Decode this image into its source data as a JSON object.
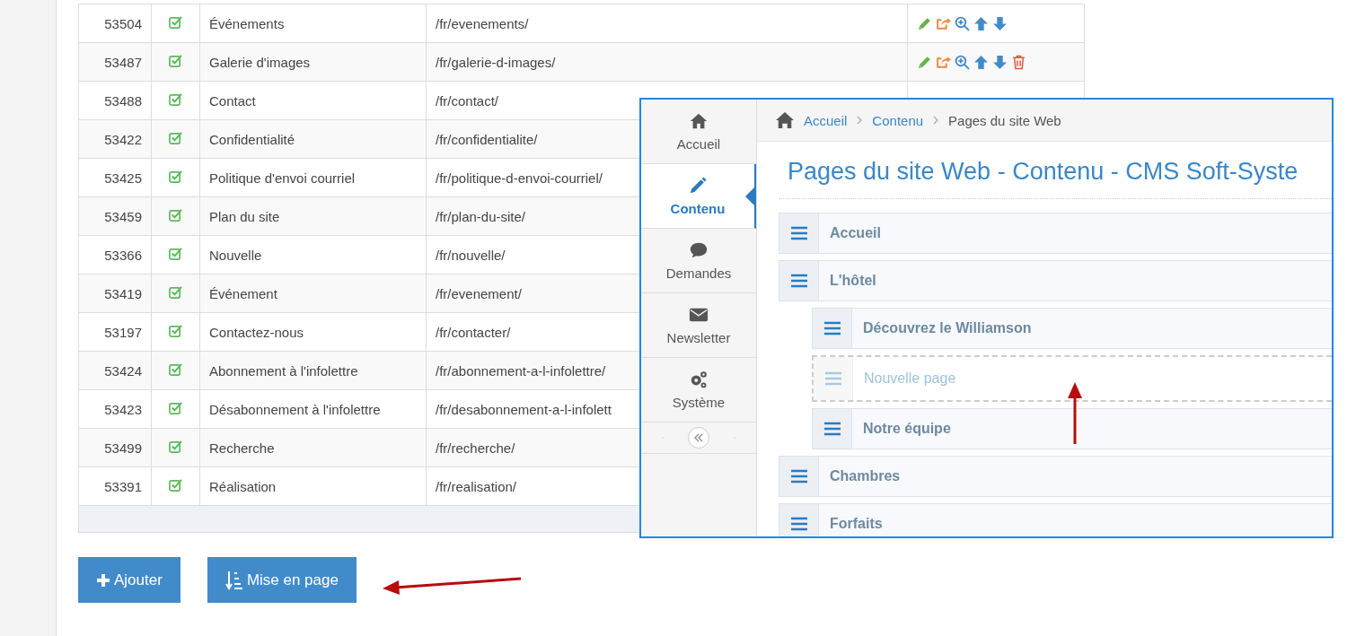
{
  "table": {
    "rows": [
      {
        "id": "53504",
        "published": true,
        "title": "Événements",
        "path": "/fr/evenements/",
        "actions": [
          {
            "kind": "edit"
          },
          {
            "kind": "share"
          },
          {
            "kind": "zoom"
          },
          {
            "kind": "up"
          },
          {
            "kind": "down"
          }
        ]
      },
      {
        "id": "53487",
        "published": true,
        "title": "Galerie d'images",
        "path": "/fr/galerie-d-images/",
        "actions": [
          {
            "kind": "edit"
          },
          {
            "kind": "share"
          },
          {
            "kind": "zoom"
          },
          {
            "kind": "up"
          },
          {
            "kind": "down"
          },
          {
            "kind": "delete"
          }
        ]
      },
      {
        "id": "53488",
        "published": true,
        "title": "Contact",
        "path": "/fr/contact/"
      },
      {
        "id": "53422",
        "published": true,
        "title": "Confidentialité",
        "path": "/fr/confidentialite/"
      },
      {
        "id": "53425",
        "published": true,
        "title": "Politique d'envoi courriel",
        "path": "/fr/politique-d-envoi-courriel/"
      },
      {
        "id": "53459",
        "published": true,
        "title": "Plan du site",
        "path": "/fr/plan-du-site/"
      },
      {
        "id": "53366",
        "published": true,
        "title": "Nouvelle",
        "path": "/fr/nouvelle/"
      },
      {
        "id": "53419",
        "published": true,
        "title": "Événement",
        "path": "/fr/evenement/"
      },
      {
        "id": "53197",
        "published": true,
        "title": "Contactez-nous",
        "path": "/fr/contacter/"
      },
      {
        "id": "53424",
        "published": true,
        "title": "Abonnement à l'infolettre",
        "path": "/fr/abonnement-a-l-infolettre/"
      },
      {
        "id": "53423",
        "published": true,
        "title": "Désabonnement à l'infolettre",
        "path": "/fr/desabonnement-a-l-infolett"
      },
      {
        "id": "53499",
        "published": true,
        "title": "Recherche",
        "path": "/fr/recherche/"
      },
      {
        "id": "53391",
        "published": true,
        "title": "Réalisation",
        "path": "/fr/realisation/"
      }
    ]
  },
  "buttons": [
    {
      "kind": "add",
      "label": "Ajouter"
    },
    {
      "kind": "layout",
      "label": "Mise en page"
    }
  ],
  "inset": {
    "sidebar": {
      "items": [
        {
          "kind": "home",
          "label": "Accueil",
          "selected": false
        },
        {
          "kind": "edit",
          "label": "Contenu",
          "selected": true
        },
        {
          "kind": "comment",
          "label": "Demandes",
          "selected": false
        },
        {
          "kind": "mail",
          "label": "Newsletter",
          "selected": false
        },
        {
          "kind": "gears",
          "label": "Système",
          "selected": false
        }
      ]
    },
    "breadcrumb": [
      {
        "label": "Accueil",
        "link": true
      },
      {
        "label": "Contenu",
        "link": true
      },
      {
        "label": "Pages du site Web",
        "link": false
      }
    ],
    "title": "Pages du site Web - Contenu - CMS Soft-Syste",
    "tree": [
      {
        "kind": "page",
        "label": "Accueil"
      },
      {
        "kind": "page",
        "label": "L'hôtel",
        "children": [
          {
            "kind": "page",
            "label": "Découvrez le Williamson"
          },
          {
            "kind": "placeholder",
            "label": "Nouvelle page"
          },
          {
            "kind": "page",
            "label": "Notre équipe"
          }
        ]
      },
      {
        "kind": "page",
        "label": "Chambres"
      },
      {
        "kind": "page",
        "label": "Forfaits"
      }
    ]
  }
}
